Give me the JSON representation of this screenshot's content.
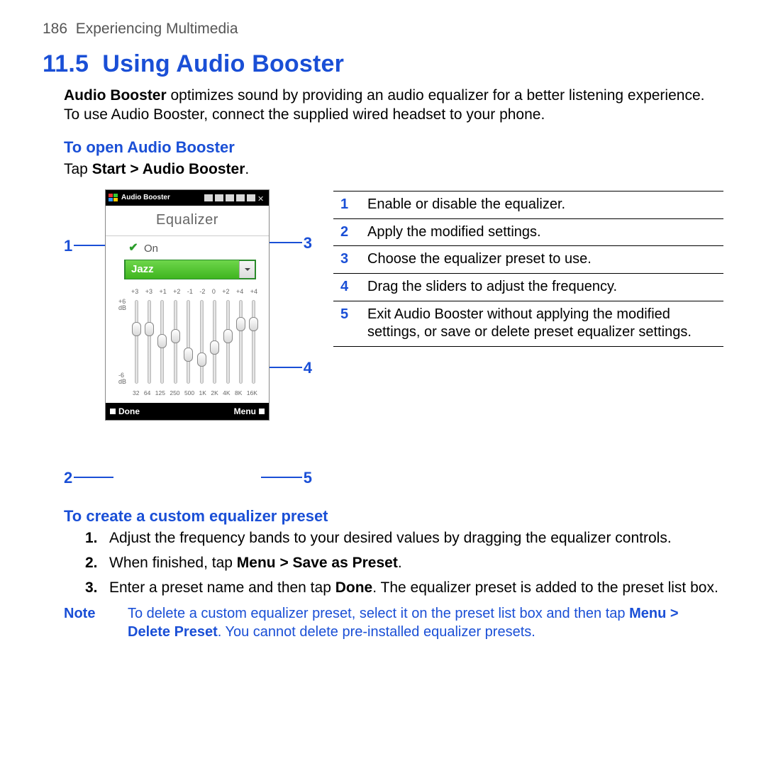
{
  "page": {
    "number": "186",
    "chapter": "Experiencing Multimedia"
  },
  "section": {
    "number": "11.5",
    "title": "Using Audio Booster"
  },
  "intro": {
    "bold": "Audio Booster",
    "rest": " optimizes sound by providing an audio equalizer for a better listening experience. To use Audio Booster, connect the supplied wired headset to your phone."
  },
  "open_heading": "To open Audio Booster",
  "tap_line": {
    "prefix": "Tap ",
    "bold": "Start > Audio Booster",
    "suffix": "."
  },
  "phone": {
    "app_title": "Audio Booster",
    "section": "Equalizer",
    "on_label": "On",
    "preset": "Jazz",
    "top_values": [
      "+3",
      "+3",
      "+1",
      "+2",
      "-1",
      "-2",
      "0",
      "+2",
      "+4",
      "+4"
    ],
    "db_top": "+6 dB",
    "db_bottom": "-6 dB",
    "freqs": [
      "32",
      "64",
      "125",
      "250",
      "500",
      "1K",
      "2K",
      "4K",
      "8K",
      "16K"
    ],
    "slider_positions_pct": [
      26,
      26,
      40,
      34,
      56,
      62,
      48,
      34,
      20,
      20
    ],
    "soft_left": "Done",
    "soft_right": "Menu"
  },
  "callouts": {
    "c1": "1",
    "c2": "2",
    "c3": "3",
    "c4": "4",
    "c5": "5"
  },
  "legend": [
    {
      "n": "1",
      "t": "Enable or disable the equalizer."
    },
    {
      "n": "2",
      "t": "Apply the modified settings."
    },
    {
      "n": "3",
      "t": "Choose the equalizer preset to use."
    },
    {
      "n": "4",
      "t": "Drag the sliders to adjust the frequency."
    },
    {
      "n": "5",
      "t": "Exit Audio Booster without applying the modified settings, or save or delete preset equalizer settings."
    }
  ],
  "create_heading": "To create a custom equalizer preset",
  "steps": [
    {
      "n": "1.",
      "bold_n": false,
      "prefix": "Adjust the frequency bands to your desired values by dragging the equalizer controls.",
      "bold": "",
      "suffix": ""
    },
    {
      "n": "2.",
      "bold_n": true,
      "prefix": "When finished, tap ",
      "bold": "Menu > Save as Preset",
      "suffix": "."
    },
    {
      "n": "3.",
      "bold_n": false,
      "prefix": "Enter a preset name and then tap ",
      "bold": "Done",
      "suffix": ". The equalizer preset is added to the preset list box."
    }
  ],
  "note": {
    "label": "Note",
    "line1": "To delete a custom equalizer preset, select it on the preset list box and then tap ",
    "bold": "Menu > Delete Preset",
    "line2": ". You cannot delete pre-installed equalizer presets."
  }
}
